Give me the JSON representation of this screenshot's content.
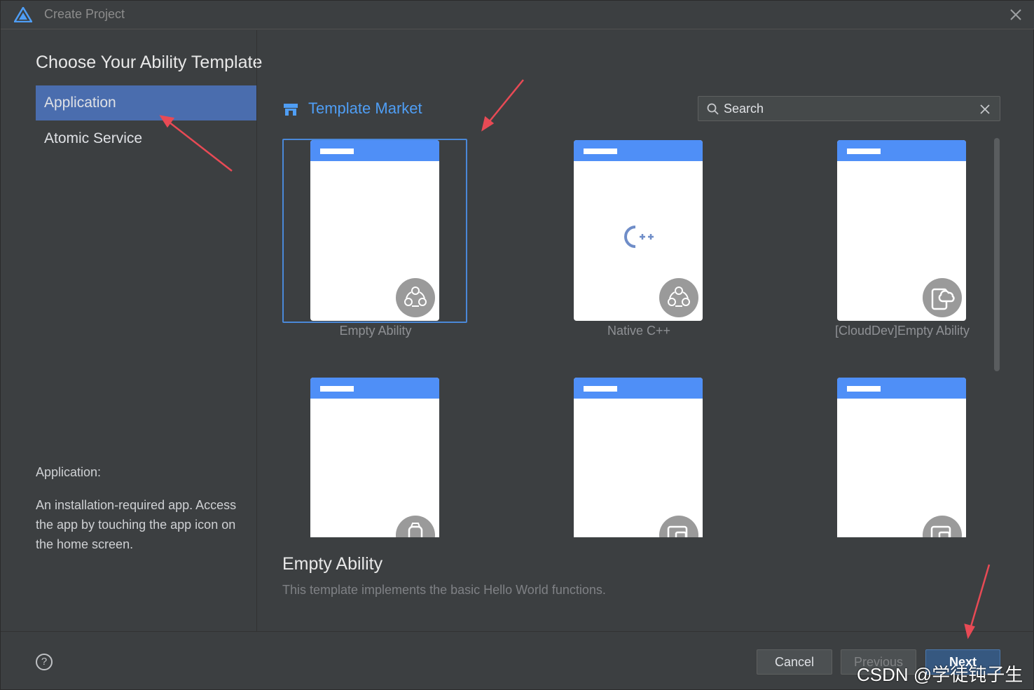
{
  "window": {
    "title": "Create Project"
  },
  "heading": "Choose Your Ability Template",
  "categories": [
    {
      "label": "Application",
      "selected": true
    },
    {
      "label": "Atomic Service",
      "selected": false
    }
  ],
  "description": {
    "title": "Application:",
    "text": "An installation-required app. Access the app by touching the app icon on the home screen."
  },
  "market": {
    "label": "Template Market"
  },
  "search": {
    "placeholder": "Search"
  },
  "templates": [
    {
      "label": "Empty Ability",
      "selected": true,
      "badge_icon": "multi-device-icon"
    },
    {
      "label": "Native C++",
      "selected": false,
      "badge_icon": "multi-device-icon",
      "center_icon": "cpp-icon"
    },
    {
      "label": "[CloudDev]Empty Ability",
      "selected": false,
      "badge_icon": "cloud-device-icon"
    },
    {
      "label": "",
      "selected": false,
      "badge_icon": "watch-icon"
    },
    {
      "label": "",
      "selected": false,
      "badge_icon": "tablet-icon"
    },
    {
      "label": "",
      "selected": false,
      "badge_icon": "tablet-icon"
    }
  ],
  "detail": {
    "title": "Empty Ability",
    "text": "This template implements the basic Hello World functions."
  },
  "footer": {
    "help": "?",
    "cancel": "Cancel",
    "previous": "Previous",
    "next": "Next"
  },
  "watermark": "CSDN @学徒钝子生",
  "colors": {
    "accent": "#4f9ef5",
    "selected_category": "#4a6dae",
    "template_header": "#4f8ff7",
    "annotation_arrow": "#e84a55"
  }
}
